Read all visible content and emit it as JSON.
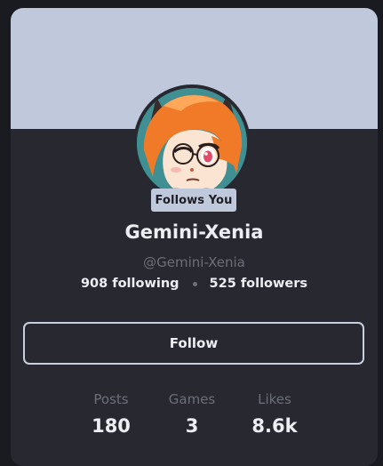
{
  "profile": {
    "badge": "Follows You",
    "display_name": "Gemini-Xenia",
    "handle": "@Gemini-Xenia",
    "following": "908 following",
    "followers": "525 followers",
    "follow_button": "Follow"
  },
  "stats": [
    {
      "label": "Posts",
      "value": "180"
    },
    {
      "label": "Games",
      "value": "3"
    },
    {
      "label": "Likes",
      "value": "8.6k"
    }
  ],
  "colors": {
    "banner": "#c0c9dc",
    "card": "#272830",
    "text": "#eceef3",
    "muted": "#6c6f7b"
  }
}
